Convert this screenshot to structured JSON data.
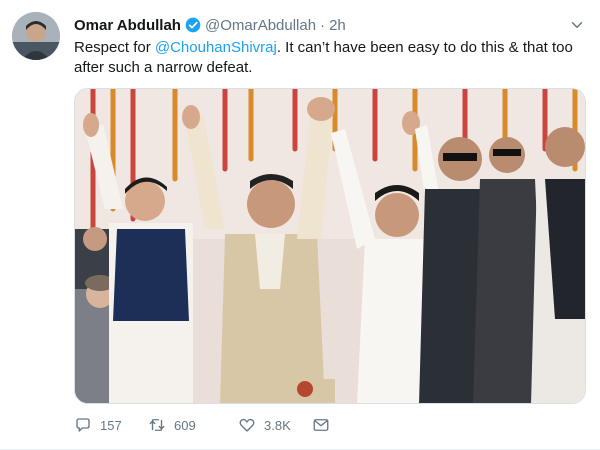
{
  "tweet": {
    "author_name": "Omar Abdullah",
    "handle": "@OmarAbdullah",
    "separator": "·",
    "time": "2h",
    "text_before": "Respect for ",
    "mention": "@ChouhanShivraj",
    "text_after": ". It can’t have been easy to do this & that too after such a narrow defeat.",
    "reply_count": "157",
    "retweet_count": "609",
    "like_count": "3.8K"
  },
  "colors": {
    "link": "#1da1f2",
    "secondary_text": "#657786",
    "verified": "#1da1f2"
  },
  "icons": {
    "verified": "verified-badge-icon",
    "menu": "chevron-down-icon",
    "reply": "reply-icon",
    "retweet": "retweet-icon",
    "like": "heart-icon",
    "message": "envelope-icon"
  }
}
